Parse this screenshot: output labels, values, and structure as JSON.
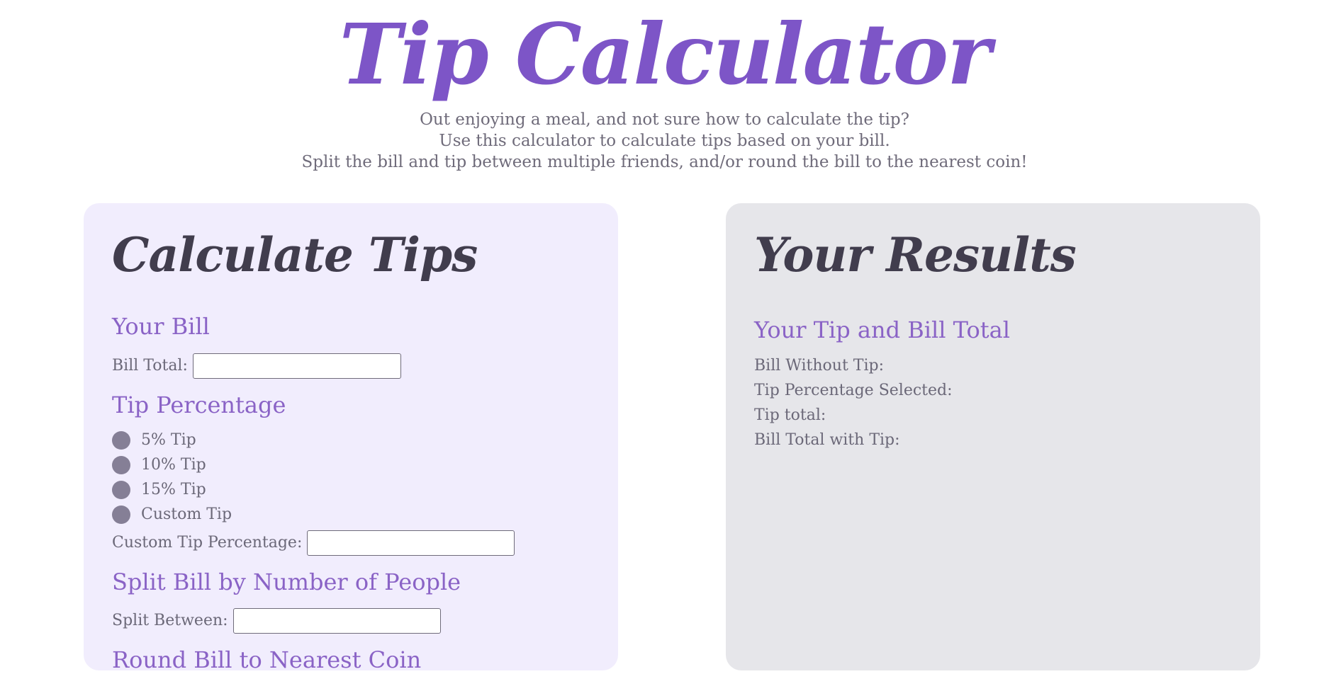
{
  "header": {
    "title": "Tip Calculator",
    "intro_lines": [
      "Out enjoying a meal, and not sure how to calculate the tip?",
      "Use this calculator to calculate tips based on your bill.",
      "Split the bill and tip between multiple friends, and/or round the bill to the nearest coin!"
    ]
  },
  "calculate": {
    "title": "Calculate Tips",
    "bill_section": "Your Bill",
    "bill_label": "Bill Total:",
    "bill_value": "",
    "tip_section": "Tip Percentage",
    "tip_options": [
      "5% Tip",
      "10% Tip",
      "15% Tip",
      "Custom Tip"
    ],
    "custom_label": "Custom Tip Percentage:",
    "custom_value": "",
    "split_section": "Split Bill by Number of People",
    "split_label": "Split Between:",
    "split_value": "",
    "round_section": "Round Bill to Nearest Coin"
  },
  "results": {
    "title": "Your Results",
    "section": "Your Tip and Bill Total",
    "lines": [
      "Bill Without Tip:",
      "Tip Percentage Selected:",
      "Tip total:",
      "Bill Total with Tip:"
    ]
  },
  "colors": {
    "accent": "#7d55c7",
    "section_heading": "#8a63c6",
    "dark_heading": "#413d4d",
    "left_panel_bg": "#f1edfd",
    "right_panel_bg": "#e6e6ea",
    "radio": "#857f96"
  }
}
